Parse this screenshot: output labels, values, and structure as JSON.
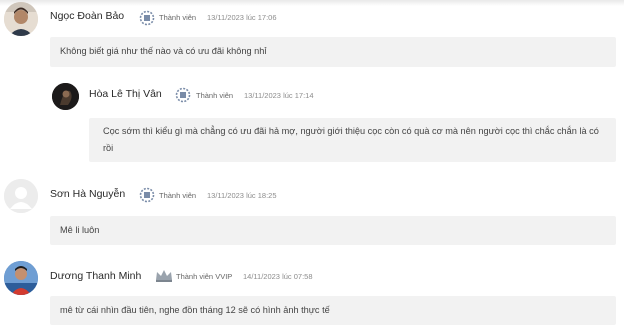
{
  "comments": [
    {
      "author": "Ngọc Đoàn Bảo",
      "role": "Thành viên",
      "timestamp": "13/11/2023 lúc 17:06",
      "text": "Không biết giá như thế nào và có ưu đãi không nhỉ",
      "avatar": "photo-avatar"
    },
    {
      "author": "Hòa Lê Thị Vân",
      "role": "Thành viên",
      "timestamp": "13/11/2023 lúc 17:14",
      "text": "Cọc sớm thì kiểu gì mà chẳng có ưu đãi hả mợ, người giới thiệu cọc còn có quà cơ mà nên người cọc thì chắc chắn là có rồi",
      "avatar": "dark-photo-avatar"
    },
    {
      "author": "Sơn Hà Nguyễn",
      "role": "Thành viên",
      "timestamp": "13/11/2023 lúc 18:25",
      "text": "Mê li luôn",
      "avatar": "default-user-avatar"
    },
    {
      "author": "Dương Thanh Minh",
      "role": "Thành viên VVIP",
      "timestamp": "14/11/2023 lúc 07:58",
      "text": "mê từ cái nhìn đầu tiên, nghe đồn tháng 12 sẽ có hình ảnh thực tế",
      "avatar": "blue-photo-avatar"
    }
  ],
  "colors": {
    "bubble": "#f2f2f2",
    "role_icon": "#7a8ca8",
    "vvip_icon": "#9aa3ad"
  }
}
